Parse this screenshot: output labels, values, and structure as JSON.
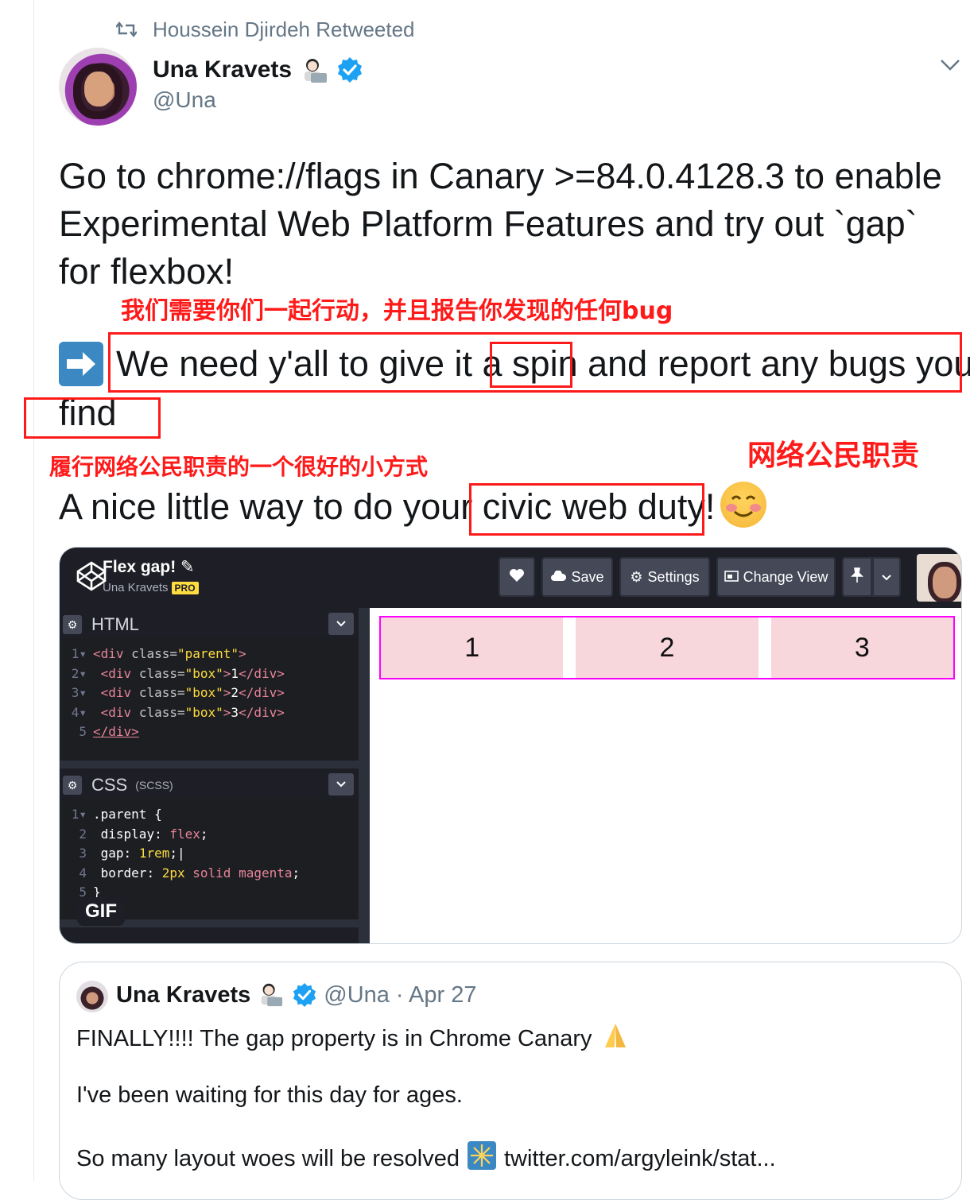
{
  "retweet": {
    "label": "Houssein Djirdeh Retweeted"
  },
  "author": {
    "name": "Una Kravets",
    "handle": "@Una"
  },
  "tweet": {
    "line1": "Go to chrome://flags in Canary >=84.0.4128.3 to enable",
    "line2": "Experimental Web Platform Features and try out `gap`",
    "line3": "for flexbox!",
    "line4_pre": "We need y'all to give it a ",
    "line4_spin": "spin",
    "line4_post": " and report any bugs you",
    "line5": "find",
    "line6_pre": "A nice little way to do your ",
    "line6_hl": "civic web duty",
    "line6_post": "!"
  },
  "annotations": {
    "cn1": "我们需要你们一起行动，并且报告你发现的任何bug",
    "cn2": "履行网络公民职责的一个很好的小方式",
    "cn3": "网络公民职责"
  },
  "codepen": {
    "title": "Flex gap!",
    "author": "Una Kravets",
    "pro": "PRO",
    "buttons": {
      "save": "Save",
      "settings": "Settings",
      "change_view": "Change View"
    },
    "html_panel": "HTML",
    "css_panel": "CSS",
    "css_sub": "(SCSS)",
    "gif_badge": "GIF",
    "preview_boxes": [
      "1",
      "2",
      "3"
    ]
  },
  "quote": {
    "name": "Una Kravets",
    "handle": "@Una",
    "date": "· Apr 27",
    "line1": "FINALLY!!!! The gap property is in Chrome Canary",
    "line2": "I've been waiting for this day for ages.",
    "line3_pre": "So many layout woes will be resolved",
    "line3_link": "twitter.com/argyleink/stat..."
  },
  "colors": {
    "accent": "#1da1f2",
    "annotation": "#ff1a1a",
    "magenta": "#ff00ff"
  }
}
